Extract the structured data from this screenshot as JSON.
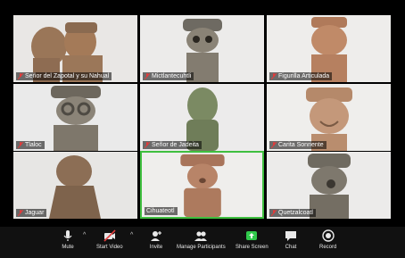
{
  "participants": [
    {
      "name": "Señor del Zapotal y su Nahual",
      "bg": "#e9e7e5"
    },
    {
      "name": "Mictlantecuhtli",
      "bg": "#ecebea"
    },
    {
      "name": "Figurilla Articulada",
      "bg": "#eeedeb"
    },
    {
      "name": "Tlaloc",
      "bg": "#eaeaea"
    },
    {
      "name": "Señor de Jadeita",
      "bg": "#ecebeb"
    },
    {
      "name": "Carita Sonriente",
      "bg": "#efeeec"
    },
    {
      "name": "Jaguar",
      "bg": "#e7e6e4"
    },
    {
      "name": "Cihuateotl",
      "bg": "#efeeec"
    },
    {
      "name": "Quetzalcoatl",
      "bg": "#ecebea"
    }
  ],
  "active_speaker": "Cihuateotl",
  "toolbar": {
    "mute": "Mute",
    "start_video": "Start Video",
    "invite": "Invite",
    "manage_participants": "Manage Participants",
    "share_screen": "Share Screen",
    "chat": "Chat",
    "record": "Record"
  },
  "colors": {
    "active_border": "#3fbf3f",
    "share_screen_green": "#30c94b",
    "muted_red": "#e23b3b"
  }
}
